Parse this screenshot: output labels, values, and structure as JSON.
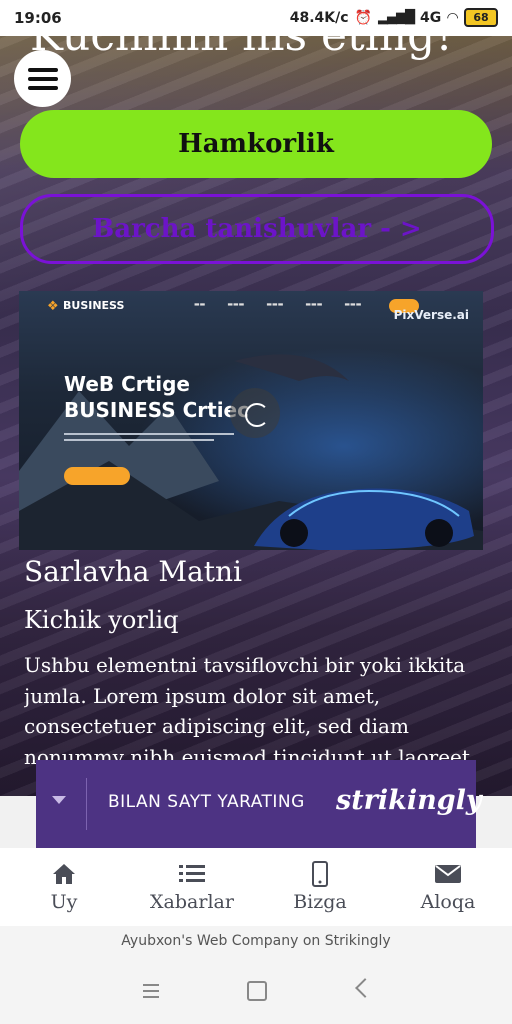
{
  "status_bar": {
    "time": "19:06",
    "net_speed": "48.4K/c",
    "network": "4G",
    "battery": "68"
  },
  "page": {
    "heading_partial": "Kuchinni his eting!",
    "primary_button": "Hamkorlik",
    "secondary_button": "Barcha tanishuvlar - >",
    "title": "Sarlavha Matni",
    "subtitle": "Kichik yorliq",
    "body": "Ushbu elementni tavsiflovchi bir yoki ikkita jumla. Lorem ipsum dolor sit amet, consectetuer adipiscing elit, sed diam nonummy nibh euismod tincidunt ut laoreet."
  },
  "hero_image": {
    "logo": "BUSINESS",
    "headline_line1": "WeB Crtige",
    "headline_line2": "BUSINESS Crtiec",
    "watermark": "PixVerse.ai"
  },
  "strikingly_banner": {
    "text": "BILAN SAYT YARATING",
    "brand": "strikingly"
  },
  "bottom_nav": [
    {
      "label": "Uy",
      "icon": "home-icon"
    },
    {
      "label": "Xabarlar",
      "icon": "list-icon"
    },
    {
      "label": "Bizga",
      "icon": "phone-icon"
    },
    {
      "label": "Aloqa",
      "icon": "mail-icon"
    }
  ],
  "footer": {
    "text": "Ayubxon's Web Company on Strikingly"
  },
  "colors": {
    "primary_button": "#84e61c",
    "secondary_border": "#7a12d6",
    "banner_bg": "#4d3383"
  }
}
